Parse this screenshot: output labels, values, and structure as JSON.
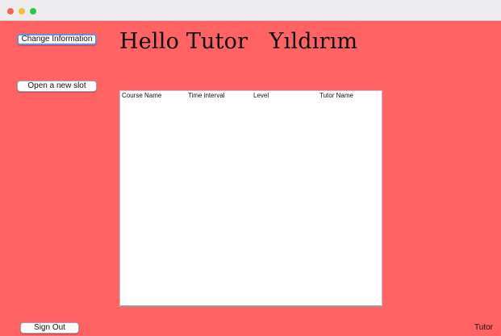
{
  "window": {
    "traffic_lights": [
      "close",
      "minimize",
      "zoom"
    ]
  },
  "colors": {
    "background": "#ff6363",
    "titlebar": "#ecebed"
  },
  "buttons": {
    "change_information": "Change Information",
    "open_new_slot": "Open a new slot",
    "sign_out": "Sign Out"
  },
  "greeting": "Hello Tutor   Yıldırım",
  "table": {
    "columns": [
      "Course Name",
      "Time interval",
      "Level",
      "Tutor Name"
    ],
    "rows": []
  },
  "role_label": "Tutor"
}
